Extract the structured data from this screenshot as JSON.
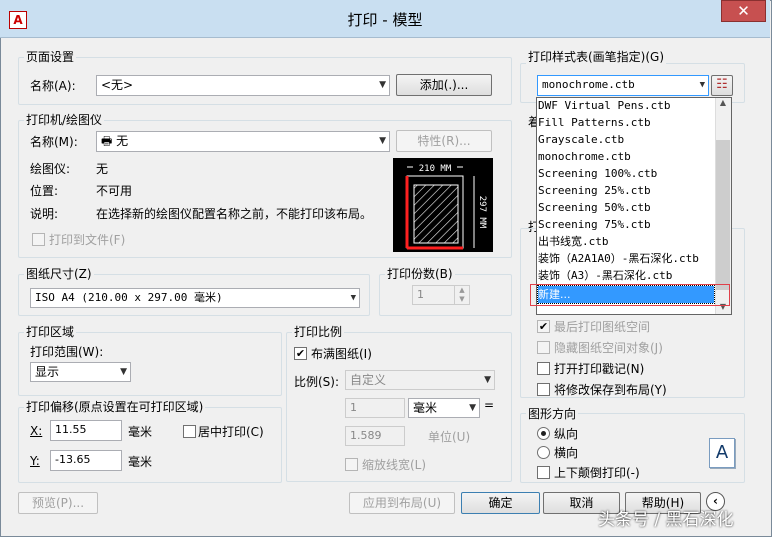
{
  "window": {
    "title": "打印 - 模型",
    "app_icon": "A",
    "close": "✕"
  },
  "background": {
    "frag1": "03",
    "frag2": "装饰完成面标高",
    "frag3": "161"
  },
  "page_setup": {
    "title": "页面设置",
    "name_label": "名称(A):",
    "name_value": "<无>",
    "add_button": "添加(.)..."
  },
  "printer": {
    "title": "打印机/绘图仪",
    "name_label": "名称(M):",
    "name_value": "无",
    "properties_button": "特性(R)...",
    "plotter_label": "绘图仪:",
    "plotter_value": "无",
    "location_label": "位置:",
    "location_value": "不可用",
    "description_label": "说明:",
    "description_value": "在选择新的绘图仪配置名称之前，不能打印该布局。",
    "print_to_file": "打印到文件(F)",
    "preview_width": "210 MM",
    "preview_height": "297 MM"
  },
  "paper_size": {
    "title": "图纸尺寸(Z)",
    "value": "ISO A4 (210.00 x 297.00 毫米)"
  },
  "copies": {
    "title": "打印份数(B)",
    "value": "1"
  },
  "print_area": {
    "title": "打印区域",
    "range_label": "打印范围(W):",
    "range_value": "显示"
  },
  "print_offset": {
    "title": "打印偏移(原点设置在可打印区域)",
    "x_label": "X:",
    "x_value": "11.55",
    "x_unit": "毫米",
    "y_label": "Y:",
    "y_value": "-13.65",
    "y_unit": "毫米",
    "center_label": "居中打印(C)"
  },
  "print_scale": {
    "title": "打印比例",
    "fit_label": "布满图纸(I)",
    "scale_label": "比例(S):",
    "scale_value": "自定义",
    "val1": "1",
    "unit1": "毫米",
    "equals": "=",
    "val2": "1.589",
    "unit2": "单位(U)",
    "lineweight_label": "缩放线宽(L)"
  },
  "plot_style": {
    "title": "打印样式表(画笔指定)(G)",
    "value": "monochrome.ctb",
    "items": [
      "DWF Virtual Pens.ctb",
      "Fill Patterns.ctb",
      "Grayscale.ctb",
      "monochrome.ctb",
      "Screening 100%.ctb",
      "Screening 25%.ctb",
      "Screening 50%.ctb",
      "Screening 75%.ctb",
      "出书线宽.ctb",
      "装饰（A2A1A0）-黑石深化.ctb",
      "装饰（A3）-黑石深化.ctb",
      "新建..."
    ],
    "partial1": "着",
    "partial2": "打"
  },
  "options": {
    "last_paper_space": "最后打印图纸空间",
    "hide_paperspace": "隐藏图纸空间对象(J)",
    "stamp_on": "打开打印戳记(N)",
    "save_changes": "将修改保存到布局(Y)"
  },
  "orientation": {
    "title": "图形方向",
    "portrait": "纵向",
    "landscape": "横向",
    "upside_down": "上下颠倒打印(-)",
    "icon_letter": "A"
  },
  "buttons": {
    "preview": "预览(P)...",
    "apply_layout": "应用到布局(U)",
    "ok": "确定",
    "cancel": "取消",
    "help": "帮助(H)"
  },
  "watermark": "头条号 / 黑石深化"
}
